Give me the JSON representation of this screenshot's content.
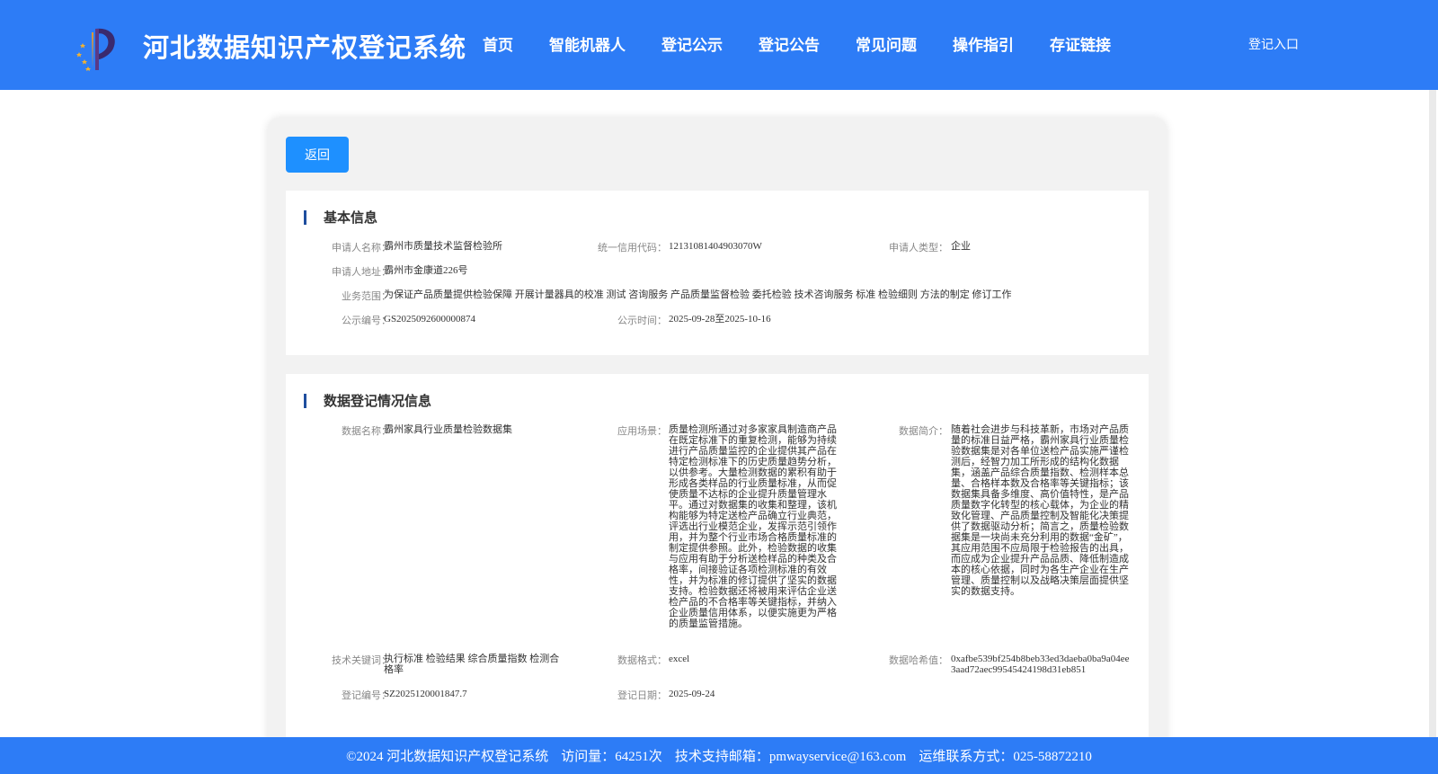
{
  "header": {
    "title": "河北数据知识产权登记系统",
    "nav": [
      "首页",
      "智能机器人",
      "登记公示",
      "登记公告",
      "常见问题",
      "操作指引",
      "存证链接"
    ],
    "login": "登记入口"
  },
  "card": {
    "back_label": "返回",
    "basic": {
      "title": "基本信息",
      "applicant_name_label": "申请人名称：",
      "applicant_name": "霸州市质量技术监督检验所",
      "credit_code_label": "统一信用代码：",
      "credit_code": "12131081404903070W",
      "applicant_type_label": "申请人类型：",
      "applicant_type": "企业",
      "address_label": "申请人地址：",
      "address": "霸州市金康道226号",
      "scope_label": "业务范围：",
      "scope": "为保证产品质量提供检验保障 开展计量器具的校准 测试 咨询服务 产品质量监督检验 委托检验 技术咨询服务 标准 检验细则 方法的制定 修订工作",
      "notice_no_label": "公示编号：",
      "notice_no": "GS2025092600000874",
      "notice_time_label": "公示时间：",
      "notice_time": "2025-09-28至2025-10-16"
    },
    "data": {
      "title": "数据登记情况信息",
      "data_name_label": "数据名称：",
      "data_name": "霸州家具行业质量检验数据集",
      "scenario_label": "应用场景：",
      "scenario": "质量检测所通过对多家家具制造商产品在既定标准下的重复检测，能够为持续进行产品质量监控的企业提供其产品在特定检测标准下的历史质量趋势分析，以供参考。大量检测数据的累积有助于形成各类样品的行业质量标准，从而促使质量不达标的企业提升质量管理水平。通过对数据集的收集和整理，该机构能够为特定送检产品确立行业典范，评选出行业模范企业，发挥示范引领作用，并为整个行业市场合格质量标准的制定提供参照。此外，检验数据的收集与应用有助于分析送检样品的种类及合格率，间接验证各项检测标准的有效性，并为标准的修订提供了坚实的数据支持。检验数据还将被用来评估企业送检产品的不合格率等关键指标，并纳入企业质量信用体系，以便实施更为严格的质量监管措施。",
      "summary_label": "数据简介：",
      "summary": "随着社会进步与科技革新，市场对产品质量的标准日益严格，霸州家具行业质量检验数据集是对各单位送检产品实施严谨检测后，经智力加工所形成的结构化数据集，涵盖产品综合质量指数、检测样本总量、合格样本数及合格率等关键指标；该数据集具备多维度、高价值特性，是产品质量数字化转型的核心载体，为企业的精致化管理、产品质量控制及智能化决策提供了数据驱动分析；简言之，质量检验数据集是一块尚未充分利用的数据“金矿”，其应用范围不应局限于检验报告的出具，而应成为企业提升产品品质、降低制造成本的核心依据，同时为各生产企业在生产管理、质量控制以及战略决策层面提供坚实的数据支持。",
      "keywords_label": "技术关键词：",
      "keywords": "执行标准 检验结果 综合质量指数 检测合格率",
      "format_label": "数据格式：",
      "format": "excel",
      "hash_label": "数据哈希值：",
      "hash": "0xafbe539bf254b8beb33ed3daeba0ba9a04ee3aad72aec99545424198d31eb851",
      "reg_no_label": "登记编号：",
      "reg_no": "SZ2025120001847.7",
      "reg_date_label": "登记日期：",
      "reg_date": "2025-09-24"
    }
  },
  "footer": {
    "copyright": "©2024 河北数据知识产权登记系统",
    "visits": "访问量：64251次",
    "email": "技术支持邮箱：pmwayservice@163.com",
    "phone": "运维联系方式：025-58872210"
  },
  "colors": {
    "brand": "#2d7cf6",
    "button": "#1e90ff",
    "accent_bar": "#1f4e9e"
  },
  "icons": {
    "logo": "torch-logo-icon"
  }
}
